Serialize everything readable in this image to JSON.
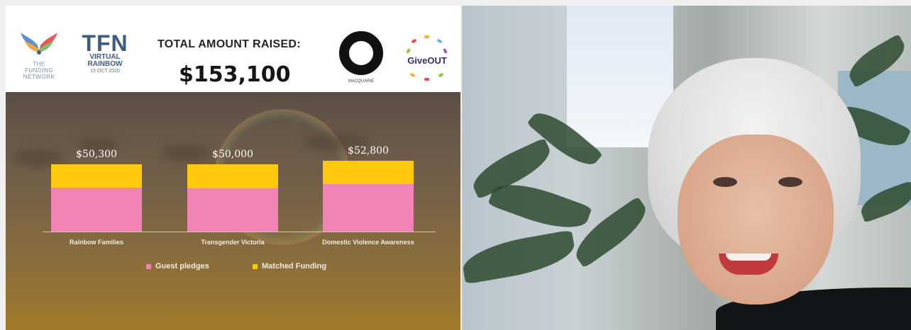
{
  "slide": {
    "total_label": "TOTAL AMOUNT RAISED:",
    "total_value": "$153,100",
    "logos": {
      "bird": {
        "lines": [
          "THE",
          "FUNDING",
          "NETWORK"
        ]
      },
      "tfn": {
        "big": "TFN",
        "line1": "VIRTUAL",
        "line2": "RAINBOW",
        "line3": "15 OCT 2020"
      },
      "ring": {
        "label": "MACQUARIE"
      },
      "giveout": {
        "label": "GiveOUT"
      }
    }
  },
  "chart_data": {
    "type": "bar",
    "stacked": true,
    "categories": [
      "Rainbow Families",
      "Transgender Victoria",
      "Domestic Violence Awareness"
    ],
    "total_labels": [
      "$50,300",
      "$50,000",
      "$52,800"
    ],
    "series": [
      {
        "name": "Guest pledges",
        "values": [
          32700,
          32300,
          35500
        ],
        "color": "#f084b6"
      },
      {
        "name": "Matched Funding",
        "values": [
          17600,
          17700,
          17300
        ],
        "color": "#ffc80a"
      }
    ],
    "ylim": [
      0,
      52800
    ],
    "legend_position": "bottom",
    "grid": false
  }
}
